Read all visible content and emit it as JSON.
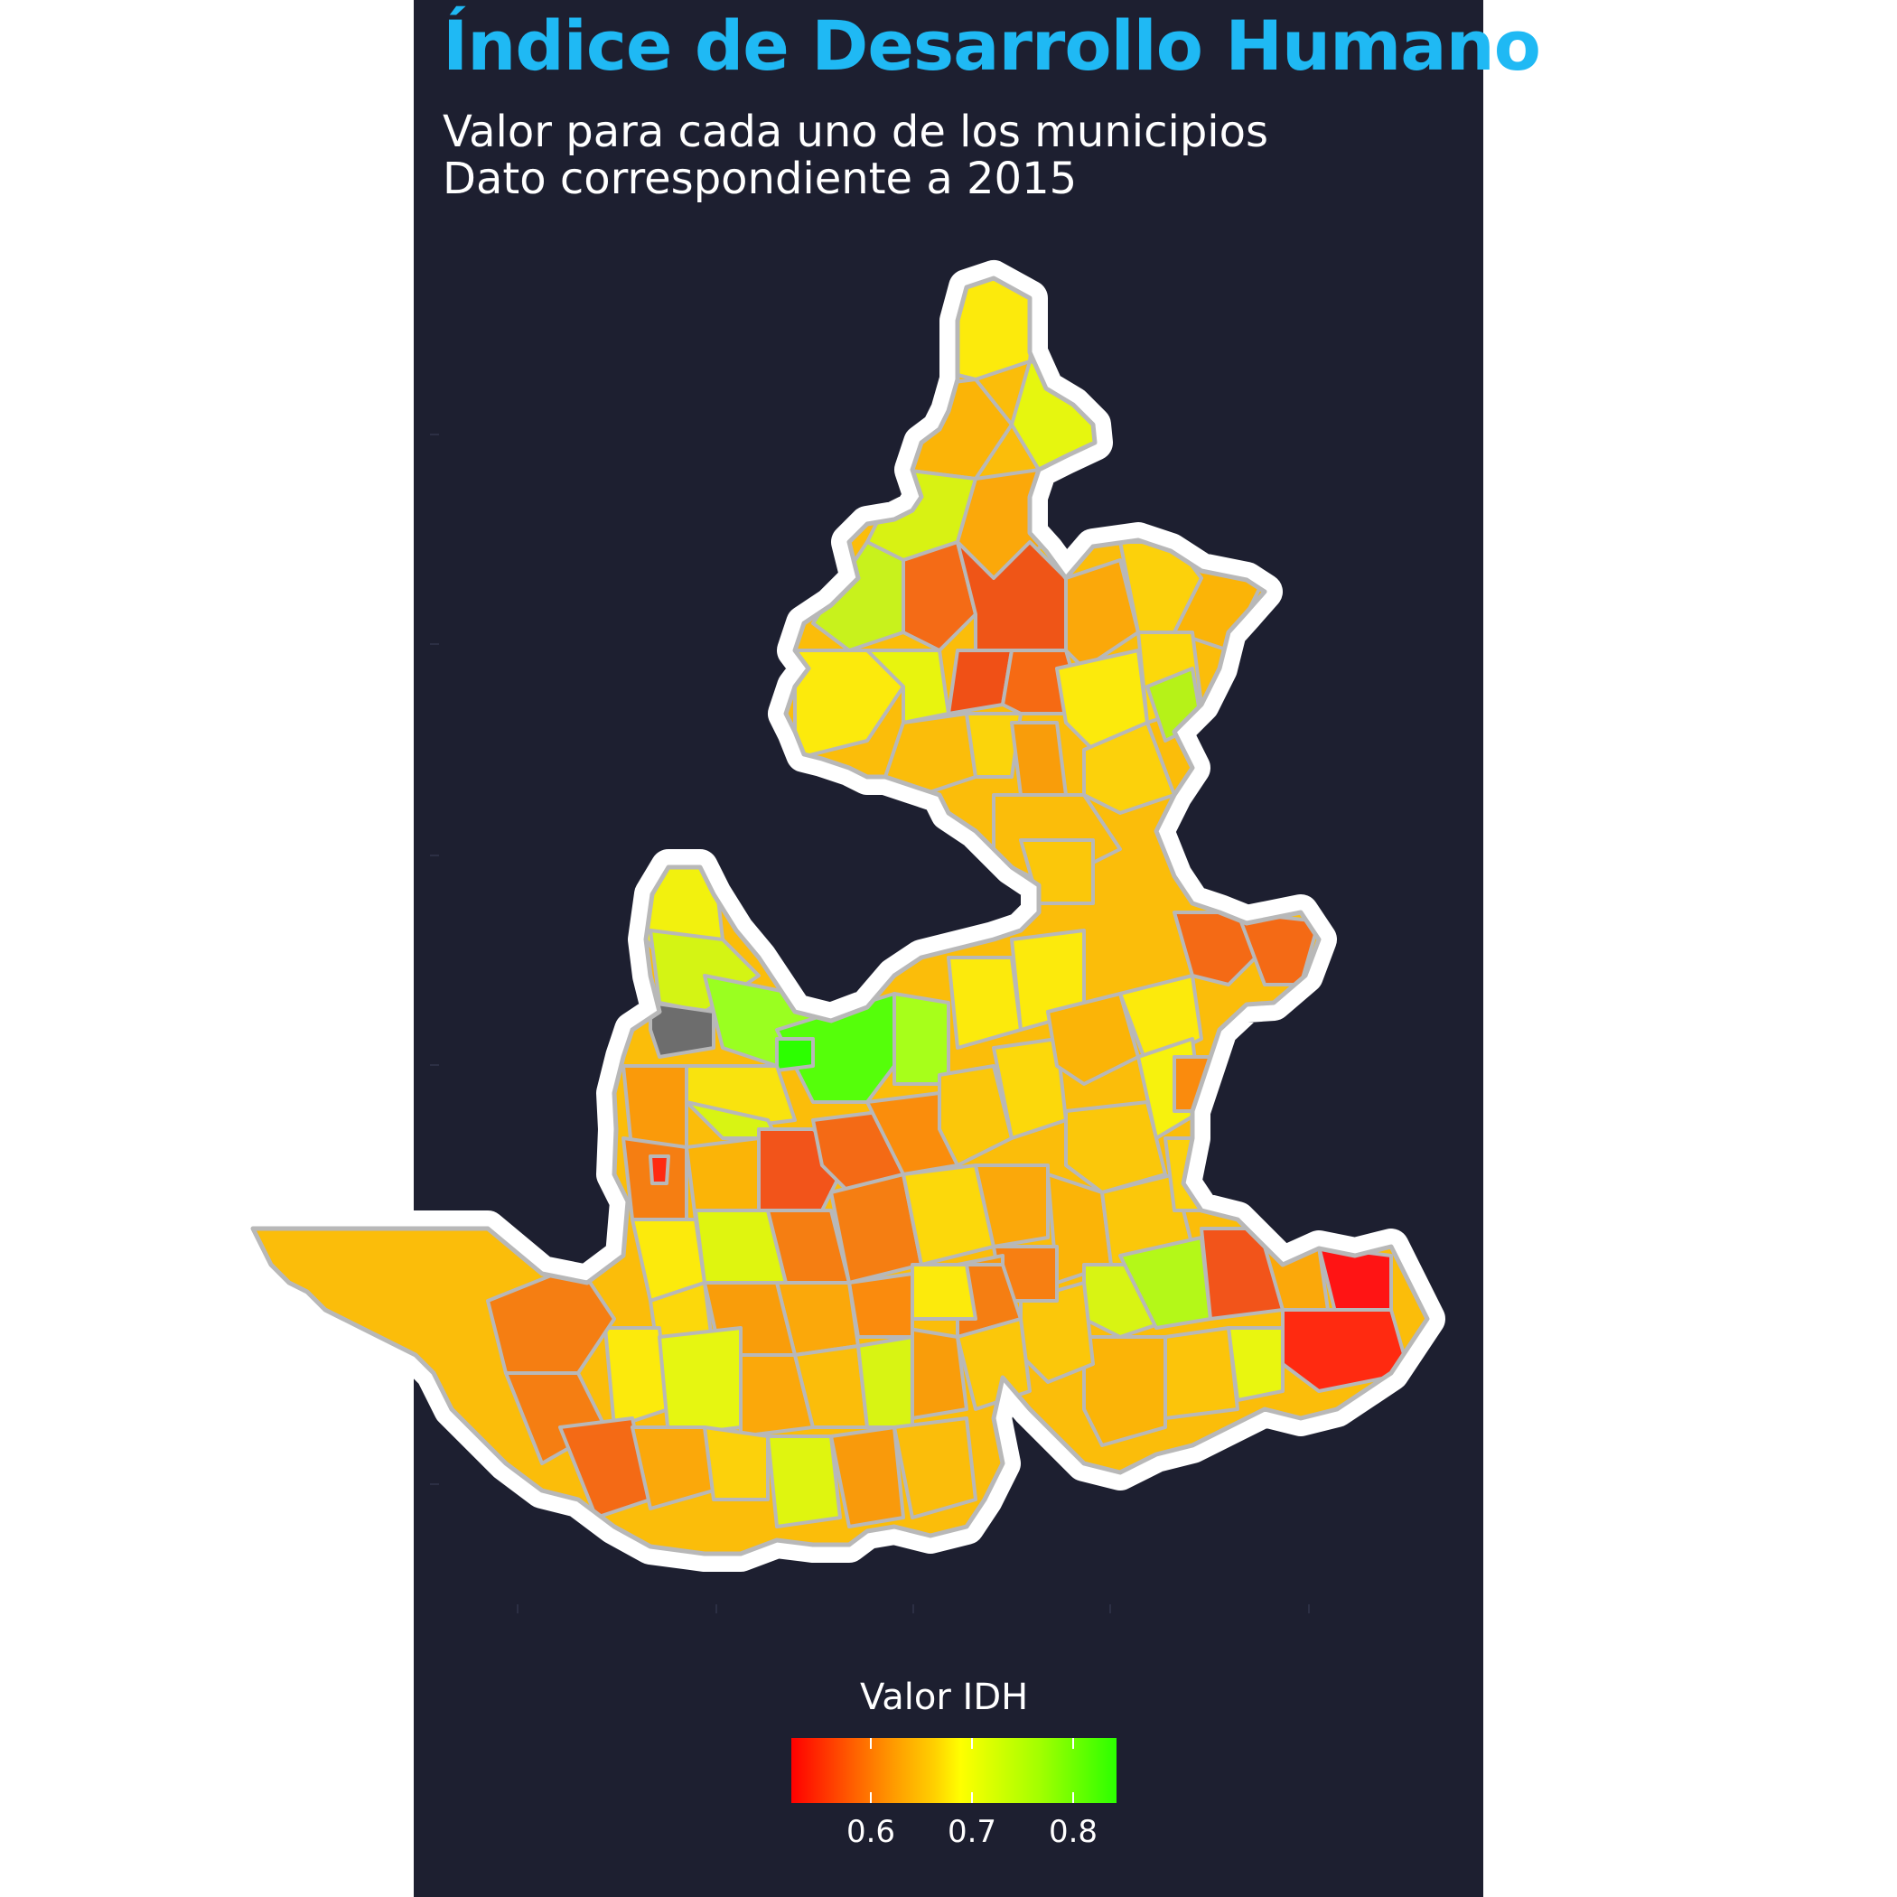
{
  "title": "Índice de Desarrollo Humano",
  "subtitle_line1": "Valor para cada uno de los municipios",
  "subtitle_line2": "Dato correspondiente a 2015",
  "legend": {
    "title": "Valor IDH",
    "ticks": [
      "0.6",
      "0.7",
      "0.8"
    ],
    "color_low": "#ff0000",
    "color_mid": "#ffff00",
    "color_high": "#2cff00",
    "no_data_color": "#707070"
  },
  "colors": {
    "background_panel": "#1d1f30",
    "title": "#1fb9f4",
    "outline": "#ffffff",
    "borders": "#b8b8b8"
  }
}
